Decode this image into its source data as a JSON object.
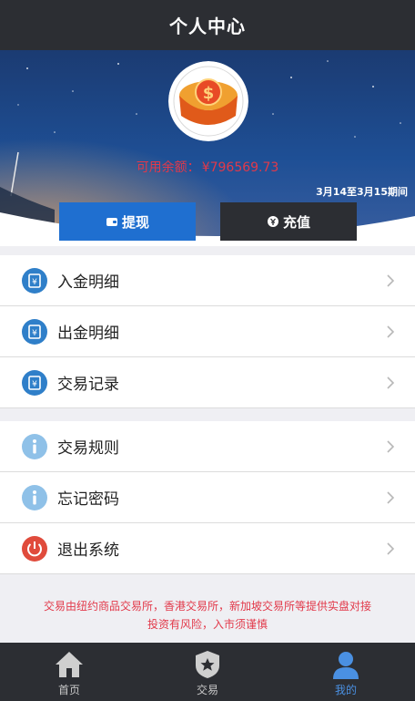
{
  "header": {
    "title": "个人中心"
  },
  "banner": {
    "balance_label": "可用余额：",
    "balance_value": "¥796569.73",
    "period": "3月14至3月15期间"
  },
  "actions": {
    "withdraw": "提现",
    "recharge": "充值"
  },
  "menu_primary": [
    {
      "label": "入金明细",
      "icon": "deposit-icon"
    },
    {
      "label": "出金明细",
      "icon": "withdrawal-icon"
    },
    {
      "label": "交易记录",
      "icon": "record-icon"
    }
  ],
  "menu_secondary": [
    {
      "label": "交易规则",
      "icon": "info-icon"
    },
    {
      "label": "忘记密码",
      "icon": "info-icon"
    },
    {
      "label": "退出系统",
      "icon": "power-icon"
    }
  ],
  "notice": {
    "line1": "交易由纽约商品交易所，香港交易所，新加坡交易所等提供实盘对接",
    "line2": "投资有风险，入市须谨慎"
  },
  "tabs": [
    {
      "label": "首页",
      "icon": "home-icon"
    },
    {
      "label": "交易",
      "icon": "trade-badge-icon"
    },
    {
      "label": "我的",
      "icon": "user-icon",
      "active": true
    }
  ],
  "colors": {
    "header_bg": "#2c2e33",
    "accent_blue": "#1f6fd0",
    "alert_red": "#e2394a",
    "active_tab": "#4a90e2"
  }
}
